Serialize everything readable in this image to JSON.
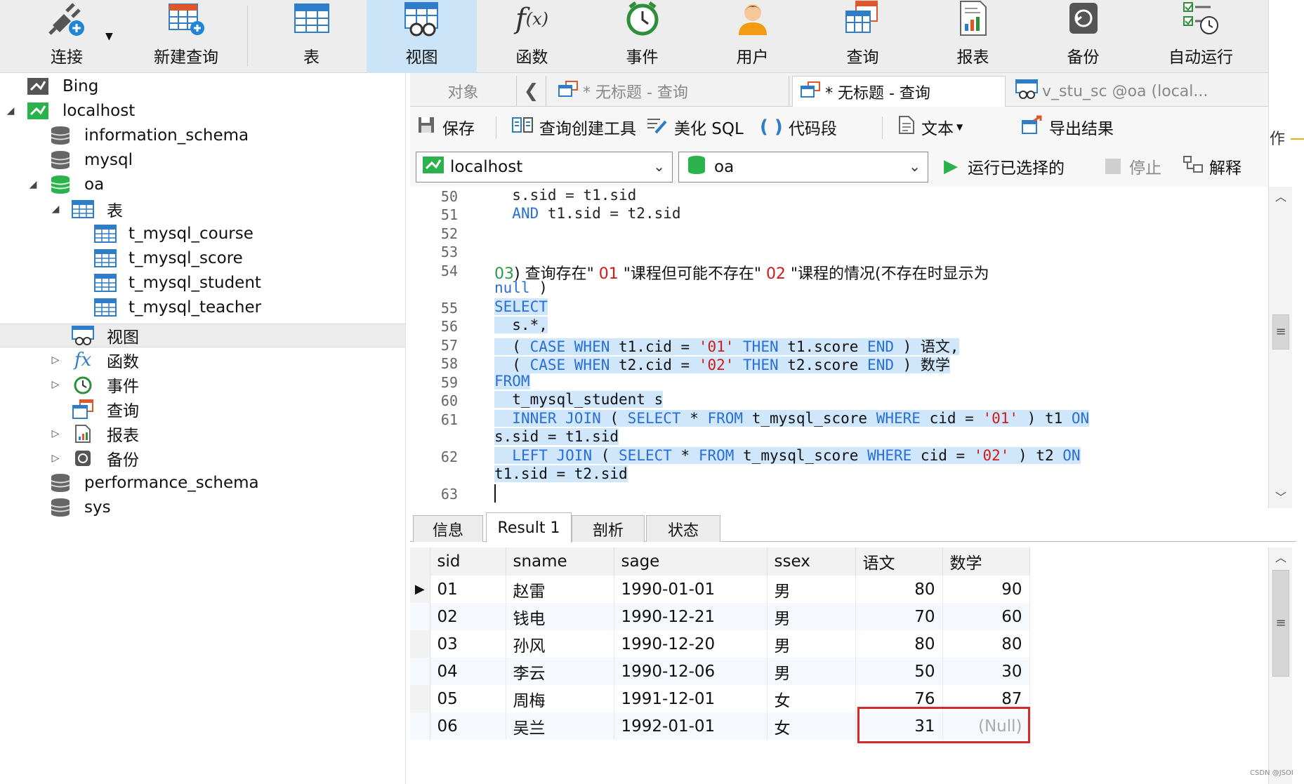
{
  "toolbar": {
    "items": [
      {
        "label": "连接",
        "icon": "plug-add-icon"
      },
      {
        "label": "新建查询",
        "icon": "new-query-icon"
      },
      {
        "label": "表",
        "icon": "table-icon"
      },
      {
        "label": "视图",
        "icon": "view-icon",
        "active": true
      },
      {
        "label": "函数",
        "icon": "function-icon"
      },
      {
        "label": "事件",
        "icon": "clock-icon"
      },
      {
        "label": "用户",
        "icon": "user-icon"
      },
      {
        "label": "查询",
        "icon": "query-icon"
      },
      {
        "label": "报表",
        "icon": "report-icon"
      },
      {
        "label": "备份",
        "icon": "backup-icon"
      },
      {
        "label": "自动运行",
        "icon": "schedule-icon"
      }
    ],
    "partial_text": "作"
  },
  "navigator": {
    "items": [
      {
        "label": "Bing",
        "icon": "connection-icon"
      },
      {
        "label": "localhost",
        "icon": "connection-green-icon",
        "expanded": true
      },
      {
        "label": "information_schema",
        "icon": "database-icon"
      },
      {
        "label": "mysql",
        "icon": "database-icon"
      },
      {
        "label": "oa",
        "icon": "database-green-icon",
        "expanded": true
      },
      {
        "label": "表",
        "icon": "table-icon",
        "expanded": true
      },
      {
        "label": "t_mysql_course",
        "icon": "table-icon"
      },
      {
        "label": "t_mysql_score",
        "icon": "table-icon"
      },
      {
        "label": "t_mysql_student",
        "icon": "table-icon"
      },
      {
        "label": "t_mysql_teacher",
        "icon": "table-icon"
      },
      {
        "label": "视图",
        "icon": "view-icon",
        "selected": true
      },
      {
        "label": "函数",
        "icon": "function-icon"
      },
      {
        "label": "事件",
        "icon": "clock-icon"
      },
      {
        "label": "查询",
        "icon": "query-icon"
      },
      {
        "label": "报表",
        "icon": "report-icon"
      },
      {
        "label": "备份",
        "icon": "backup-icon"
      },
      {
        "label": "performance_schema",
        "icon": "database-icon"
      },
      {
        "label": "sys",
        "icon": "database-icon"
      }
    ]
  },
  "tabs": {
    "objects": "对象",
    "tab1": "* 无标题 - 查询",
    "tab2": "* 无标题 - 查询",
    "tab3": "v_stu_sc @oa (local..."
  },
  "querybar": {
    "save": "保存",
    "builder": "查询创建工具",
    "beautify": "美化 SQL",
    "snippet": "代码段",
    "text": "文本",
    "export": "导出结果"
  },
  "connbar": {
    "connection": "localhost",
    "database": "oa",
    "run": "运行已选择的",
    "stop": "停止",
    "explain": "解释"
  },
  "editor": {
    "line_numbers": [
      "50",
      "51",
      "52",
      "53",
      "54",
      "",
      "55",
      "56",
      "57",
      "58",
      "59",
      "60",
      "61",
      "",
      "62",
      "",
      "63"
    ]
  },
  "results": {
    "tabs": [
      "信息",
      "Result 1",
      "剖析",
      "状态"
    ],
    "columns": [
      "sid",
      "sname",
      "sage",
      "ssex",
      "语文",
      "数学"
    ],
    "rows": [
      [
        "01",
        "赵雷",
        "1990-01-01",
        "男",
        "80",
        "90"
      ],
      [
        "02",
        "钱电",
        "1990-12-21",
        "男",
        "70",
        "60"
      ],
      [
        "03",
        "孙风",
        "1990-12-20",
        "男",
        "80",
        "80"
      ],
      [
        "04",
        "李云",
        "1990-12-06",
        "男",
        "50",
        "30"
      ],
      [
        "05",
        "周梅",
        "1991-12-01",
        "女",
        "76",
        "87"
      ],
      [
        "06",
        "吴兰",
        "1992-01-01",
        "女",
        "31",
        "(Null)"
      ]
    ],
    "current_row_marker": "▶"
  },
  "watermark": "CSDN @JSOI",
  "colors": {
    "keyword": "#2a6fd6",
    "string": "#d31919",
    "selection": "#cfe6fb",
    "highlight_box": "#d62a2a",
    "active_tab": "#cce4f7"
  }
}
